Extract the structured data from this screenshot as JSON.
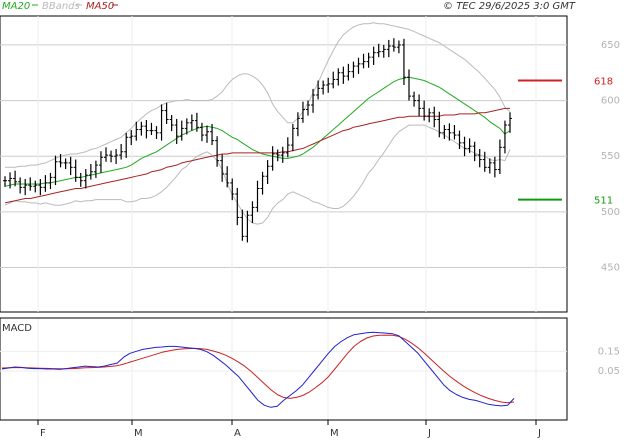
{
  "chart_data": {
    "type": "ohlc",
    "title": "",
    "timestamp": "© TEC 29/6/2025 3:0 GMT",
    "legend": [
      {
        "name": "MA20",
        "color": "#22aa22"
      },
      {
        "name": "BBands",
        "color": "#bbbbbb"
      },
      {
        "name": "MA50",
        "color": "#aa2222"
      }
    ],
    "price_axis": {
      "ylim": [
        410,
        676
      ],
      "ticks": [
        450,
        500,
        550,
        600,
        650
      ]
    },
    "months": [
      "F",
      "M",
      "A",
      "M",
      "J",
      "J"
    ],
    "levels": [
      {
        "label": "618",
        "value": 618,
        "color": "#cc2222"
      },
      {
        "label": "511",
        "value": 511,
        "color": "#119911"
      }
    ],
    "price": [
      528,
      530,
      527,
      522,
      524,
      523,
      524,
      522,
      526,
      531,
      545,
      544,
      544,
      540,
      531,
      528,
      533,
      536,
      542,
      549,
      551,
      550,
      551,
      554,
      567,
      568,
      574,
      577,
      573,
      573,
      571,
      591,
      583,
      578,
      568,
      575,
      580,
      582,
      576,
      569,
      572,
      564,
      546,
      534,
      526,
      516,
      495,
      478,
      497,
      504,
      521,
      532,
      541,
      552,
      551,
      553,
      560,
      575,
      584,
      592,
      596,
      605,
      611,
      614,
      615,
      619,
      625,
      622,
      626,
      631,
      633,
      635,
      639,
      643,
      644,
      646,
      649,
      648,
      650,
      621,
      604,
      600,
      593,
      586,
      589,
      583,
      571,
      574,
      571,
      569,
      562,
      557,
      559,
      551,
      547,
      540,
      544,
      538,
      558,
      578,
      584
    ],
    "ma20": [
      523,
      524,
      525,
      525,
      525,
      525,
      525,
      525,
      526,
      526,
      527,
      528,
      529,
      530,
      531,
      531,
      532,
      533,
      534,
      535,
      536,
      537,
      538,
      539,
      540,
      542,
      545,
      548,
      550,
      552,
      554,
      557,
      560,
      563,
      566,
      569,
      571,
      573,
      575,
      576,
      577,
      576,
      575,
      573,
      570,
      567,
      565,
      562,
      559,
      556,
      554,
      552,
      551,
      550,
      549,
      548,
      548,
      549,
      550,
      552,
      555,
      558,
      562,
      566,
      570,
      574,
      578,
      582,
      586,
      590,
      594,
      598,
      602,
      605,
      608,
      611,
      614,
      617,
      619,
      620,
      621,
      620,
      619,
      618,
      616,
      614,
      612,
      609,
      606,
      603,
      600,
      597,
      594,
      591,
      588,
      585,
      581,
      578,
      575,
      570,
      573
    ],
    "bb_upper": [
      540,
      540,
      540,
      541,
      541,
      542,
      542,
      543,
      544,
      546,
      548,
      550,
      551,
      552,
      552,
      553,
      554,
      556,
      557,
      559,
      561,
      563,
      565,
      567,
      571,
      575,
      580,
      584,
      588,
      591,
      593,
      596,
      598,
      599,
      600,
      600,
      601,
      600,
      600,
      600,
      600,
      601,
      604,
      608,
      614,
      619,
      622,
      624,
      624,
      622,
      619,
      614,
      607,
      597,
      590,
      585,
      580,
      580,
      584,
      590,
      598,
      607,
      616,
      626,
      636,
      645,
      653,
      659,
      663,
      666,
      668,
      669,
      669,
      670,
      669,
      669,
      668,
      667,
      666,
      665,
      664,
      662,
      660,
      658,
      656,
      654,
      652,
      649,
      646,
      643,
      640,
      637,
      633,
      629,
      625,
      620,
      615,
      610,
      603,
      594,
      590
    ],
    "bb_lower": [
      506,
      508,
      510,
      509,
      509,
      508,
      508,
      507,
      508,
      507,
      506,
      506,
      507,
      508,
      510,
      509,
      510,
      510,
      511,
      511,
      511,
      511,
      511,
      511,
      509,
      509,
      510,
      512,
      512,
      513,
      515,
      518,
      522,
      527,
      532,
      538,
      541,
      546,
      550,
      552,
      554,
      551,
      546,
      538,
      526,
      515,
      508,
      500,
      494,
      490,
      489,
      490,
      495,
      503,
      508,
      511,
      516,
      518,
      516,
      514,
      512,
      509,
      508,
      506,
      504,
      503,
      503,
      505,
      509,
      514,
      520,
      527,
      535,
      540,
      547,
      553,
      560,
      567,
      572,
      575,
      578,
      578,
      578,
      578,
      576,
      574,
      572,
      569,
      566,
      563,
      560,
      557,
      555,
      553,
      551,
      550,
      547,
      546,
      547,
      546,
      556
    ],
    "ma50": [
      508,
      509,
      510,
      511,
      512,
      512,
      513,
      514,
      515,
      516,
      517,
      518,
      519,
      520,
      521,
      521,
      522,
      523,
      524,
      525,
      526,
      527,
      528,
      529,
      530,
      531,
      532,
      533,
      534,
      536,
      537,
      538,
      540,
      541,
      542,
      544,
      545,
      546,
      547,
      548,
      549,
      550,
      551,
      552,
      552,
      553,
      553,
      553,
      553,
      553,
      553,
      553,
      553,
      553,
      553,
      554,
      554,
      555,
      556,
      557,
      559,
      561,
      563,
      565,
      567,
      569,
      571,
      573,
      574,
      576,
      577,
      578,
      579,
      580,
      581,
      582,
      583,
      584,
      585,
      585,
      586,
      586,
      586,
      586,
      586,
      586,
      586,
      587,
      587,
      587,
      588,
      588,
      588,
      588,
      589,
      589,
      590,
      591,
      592,
      593,
      593
    ],
    "macd": {
      "label": "MACD",
      "ylim": [
        -0.2,
        0.32
      ],
      "ticks": [
        {
          "value": 0.15,
          "label": "0.15"
        },
        {
          "value": 0.05,
          "label": "0.05"
        }
      ],
      "line": [
        0.06,
        0.065,
        0.07,
        0.068,
        0.064,
        0.062,
        0.062,
        0.06,
        0.06,
        0.058,
        0.062,
        0.066,
        0.07,
        0.075,
        0.072,
        0.07,
        0.075,
        0.083,
        0.09,
        0.12,
        0.14,
        0.15,
        0.16,
        0.165,
        0.17,
        0.172,
        0.175,
        0.175,
        0.172,
        0.168,
        0.165,
        0.16,
        0.148,
        0.13,
        0.105,
        0.08,
        0.05,
        0.02,
        -0.02,
        -0.06,
        -0.1,
        -0.125,
        -0.135,
        -0.13,
        -0.1,
        -0.075,
        -0.05,
        -0.02,
        0.02,
        0.06,
        0.1,
        0.14,
        0.175,
        0.2,
        0.22,
        0.235,
        0.24,
        0.245,
        0.247,
        0.245,
        0.243,
        0.24,
        0.23,
        0.2,
        0.17,
        0.14,
        0.1,
        0.06,
        0.02,
        -0.02,
        -0.05,
        -0.07,
        -0.085,
        -0.095,
        -0.1,
        -0.11,
        -0.12,
        -0.125,
        -0.128,
        -0.125,
        -0.09
      ],
      "signal": [
        0.065,
        0.066,
        0.067,
        0.067,
        0.066,
        0.065,
        0.064,
        0.063,
        0.062,
        0.061,
        0.061,
        0.062,
        0.064,
        0.066,
        0.067,
        0.068,
        0.07,
        0.073,
        0.077,
        0.085,
        0.095,
        0.105,
        0.115,
        0.125,
        0.135,
        0.145,
        0.152,
        0.158,
        0.162,
        0.164,
        0.165,
        0.164,
        0.16,
        0.152,
        0.142,
        0.13,
        0.113,
        0.094,
        0.072,
        0.045,
        0.015,
        -0.015,
        -0.045,
        -0.07,
        -0.085,
        -0.09,
        -0.085,
        -0.075,
        -0.058,
        -0.035,
        -0.01,
        0.02,
        0.06,
        0.1,
        0.14,
        0.175,
        0.2,
        0.218,
        0.228,
        0.232,
        0.233,
        0.232,
        0.226,
        0.212,
        0.192,
        0.168,
        0.14,
        0.11,
        0.08,
        0.05,
        0.022,
        -0.002,
        -0.025,
        -0.045,
        -0.062,
        -0.077,
        -0.09,
        -0.1,
        -0.108,
        -0.112,
        -0.108
      ]
    }
  }
}
